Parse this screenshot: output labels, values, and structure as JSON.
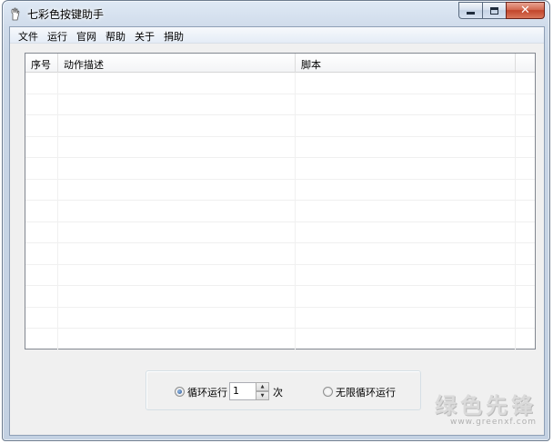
{
  "window": {
    "title": "七彩色按键助手"
  },
  "menu": [
    {
      "label": "文件"
    },
    {
      "label": "运行"
    },
    {
      "label": "官网"
    },
    {
      "label": "帮助"
    },
    {
      "label": "关于"
    },
    {
      "label": "捐助"
    }
  ],
  "listview": {
    "columns": [
      {
        "label": "序号"
      },
      {
        "label": "动作描述"
      },
      {
        "label": "脚本"
      },
      {
        "label": ""
      }
    ],
    "rows": []
  },
  "loop": {
    "loop_label": "循环运行",
    "count_value": "1",
    "times_label": "次",
    "infinite_label": "无限循环运行",
    "selected": "loop"
  },
  "watermark": {
    "text": "绿色先锋",
    "url": "www.greenxf.com"
  }
}
